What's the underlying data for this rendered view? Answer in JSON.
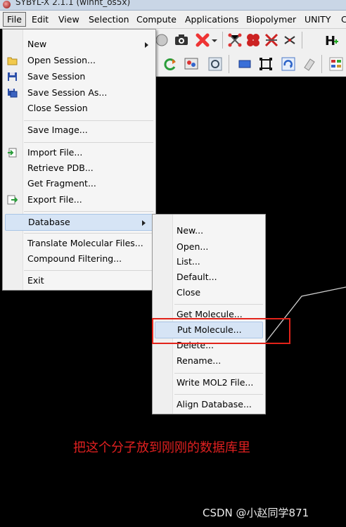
{
  "window": {
    "title": "SYBYL-X 2.1.1 (winnt_os5x)"
  },
  "menubar": {
    "items": [
      "File",
      "Edit",
      "View",
      "Selection",
      "Compute",
      "Applications",
      "Biopolymer",
      "UNITY",
      "C"
    ]
  },
  "file_menu": {
    "new": "New",
    "open_session": "Open Session...",
    "save_session": "Save Session",
    "save_session_as": "Save Session As...",
    "close_session": "Close Session",
    "save_image": "Save Image...",
    "import_file": "Import File...",
    "retrieve_pdb": "Retrieve PDB...",
    "get_fragment": "Get Fragment...",
    "export_file": "Export File...",
    "database": "Database",
    "translate_files": "Translate Molecular Files...",
    "compound_filtering": "Compound Filtering...",
    "exit": "Exit"
  },
  "database_menu": {
    "new": "New...",
    "open": "Open...",
    "list": "List...",
    "default": "Default...",
    "close": "Close",
    "get_molecule": "Get Molecule...",
    "put_molecule": "Put Molecule...",
    "delete": "Delete...",
    "rename": "Rename...",
    "write_mol2": "Write MOL2 File...",
    "align_database": "Align Database..."
  },
  "annotation": {
    "text": "把这个分子放到刚刚的数据库里"
  },
  "watermark": {
    "text": "CSDN @小赵同学871"
  },
  "colors": {
    "highlight_box": "#e2231a",
    "canvas_bg": "#000000",
    "annotation": "#e02020"
  },
  "icons": {
    "toolbar1": [
      "camera-icon",
      "delete-x-icon",
      "bond-icon",
      "ring-icon",
      "break-bond-icon",
      "cross-bond-icon",
      "add-hydrogen-icon"
    ],
    "toolbar2": [
      "refresh-icon",
      "display-icon",
      "settings-icon",
      "select-box-icon",
      "fit-screen-icon",
      "rotate-icon",
      "erase-icon",
      "label-icon"
    ]
  }
}
